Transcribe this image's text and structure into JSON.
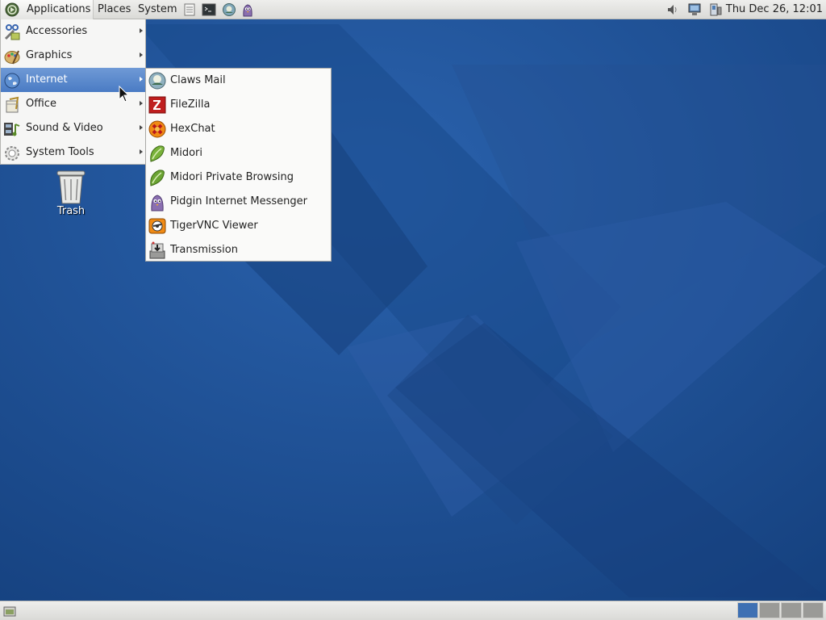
{
  "top_panel": {
    "menus": {
      "applications": "Applications",
      "places": "Places",
      "system": "System"
    },
    "launchers": [
      "notes-icon",
      "terminal-icon",
      "claws-mail-icon",
      "pidgin-icon"
    ],
    "clock": "Thu Dec 26, 12:01",
    "tray": [
      "volume-icon",
      "network-icon",
      "power-icon"
    ]
  },
  "applications_menu": {
    "items": [
      {
        "label": "Accessories",
        "icon": "accessories-icon"
      },
      {
        "label": "Graphics",
        "icon": "graphics-icon"
      },
      {
        "label": "Internet",
        "icon": "internet-globe-icon",
        "active": true
      },
      {
        "label": "Office",
        "icon": "office-icon"
      },
      {
        "label": "Sound & Video",
        "icon": "sound-video-icon"
      },
      {
        "label": "System Tools",
        "icon": "system-tools-icon"
      }
    ]
  },
  "internet_submenu": {
    "items": [
      {
        "label": "Claws Mail",
        "icon": "claws-mail-icon"
      },
      {
        "label": "FileZilla",
        "icon": "filezilla-icon"
      },
      {
        "label": "HexChat",
        "icon": "hexchat-icon"
      },
      {
        "label": "Midori",
        "icon": "midori-icon"
      },
      {
        "label": "Midori Private Browsing",
        "icon": "midori-private-icon"
      },
      {
        "label": "Pidgin Internet Messenger",
        "icon": "pidgin-icon"
      },
      {
        "label": "TigerVNC Viewer",
        "icon": "tigervnc-icon"
      },
      {
        "label": "Transmission",
        "icon": "transmission-icon"
      }
    ]
  },
  "desktop": {
    "trash_label": "Trash"
  },
  "bottom_panel": {
    "workspaces": 4,
    "active_workspace": 1
  },
  "colors": {
    "wallpaper": "#1c4f94",
    "highlight": "#4a7bc4",
    "panel": "#e4e4e2"
  }
}
